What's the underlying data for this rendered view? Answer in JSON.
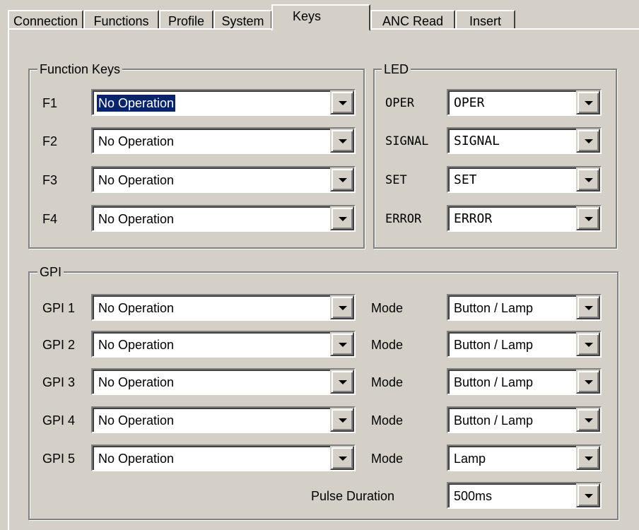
{
  "tabs": [
    {
      "label": "Connection"
    },
    {
      "label": "Functions"
    },
    {
      "label": "Profile"
    },
    {
      "label": "System"
    },
    {
      "label": "Keys"
    },
    {
      "label": "ANC Read"
    },
    {
      "label": "Insert"
    }
  ],
  "function_keys": {
    "title": "Function Keys",
    "rows": [
      {
        "label": "F1",
        "value": "No Operation"
      },
      {
        "label": "F2",
        "value": "No Operation"
      },
      {
        "label": "F3",
        "value": "No Operation"
      },
      {
        "label": "F4",
        "value": "No Operation"
      }
    ]
  },
  "led": {
    "title": "LED",
    "rows": [
      {
        "label": "OPER",
        "value": "OPER"
      },
      {
        "label": "SIGNAL",
        "value": "SIGNAL"
      },
      {
        "label": "SET",
        "value": "SET"
      },
      {
        "label": "ERROR",
        "value": "ERROR"
      }
    ]
  },
  "gpi": {
    "title": "GPI",
    "mode_label": "Mode",
    "rows": [
      {
        "label": "GPI 1",
        "value": "No Operation",
        "mode": "Button / Lamp"
      },
      {
        "label": "GPI 2",
        "value": "No Operation",
        "mode": "Button / Lamp"
      },
      {
        "label": "GPI 3",
        "value": "No Operation",
        "mode": "Button / Lamp"
      },
      {
        "label": "GPI 4",
        "value": "No Operation",
        "mode": "Button / Lamp"
      },
      {
        "label": "GPI 5",
        "value": "No Operation",
        "mode": "Lamp"
      }
    ],
    "pulse_label": "Pulse Duration",
    "pulse_value": "500ms"
  }
}
